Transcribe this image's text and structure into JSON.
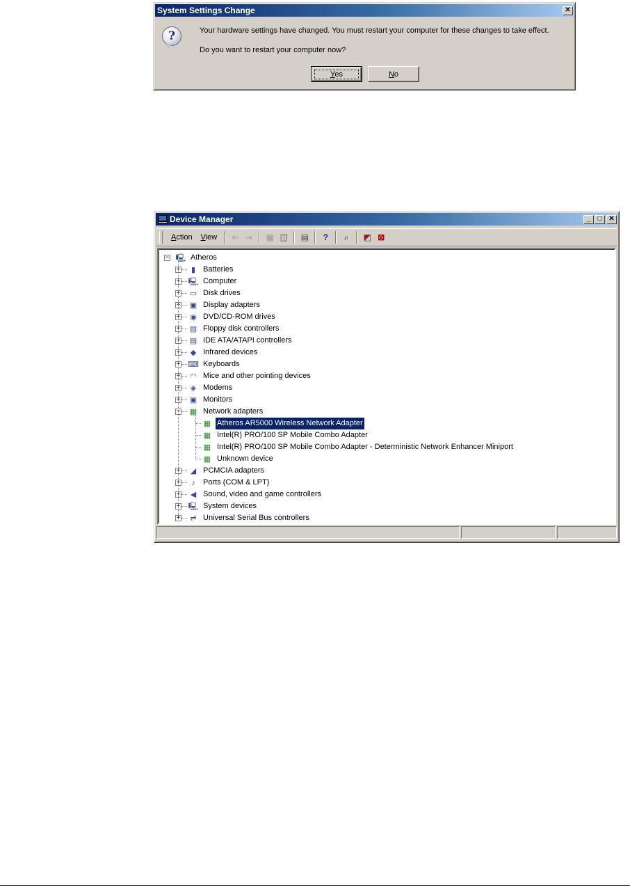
{
  "dialog": {
    "title": "System Settings Change",
    "close_glyph": "✕",
    "icon": "question-icon",
    "icon_glyph": "?",
    "message": "Your hardware settings have changed. You must restart your computer for these changes to take effect.",
    "question": "Do you want to restart your computer now?",
    "yes_first": "Y",
    "yes_rest": "es",
    "no_first": "N",
    "no_rest": "o"
  },
  "device_manager": {
    "title": "Device Manager",
    "window_buttons": {
      "minimize": "_",
      "maximize": "□",
      "close": "✕"
    },
    "menus": [
      {
        "first": "A",
        "rest": "ction"
      },
      {
        "first": "V",
        "rest": "iew"
      }
    ],
    "toolbar_icons": {
      "back": "⇐",
      "forward": "⇒",
      "up": "▦",
      "show_hide": "◫",
      "properties": "▤",
      "help": "?",
      "scan": "⌕",
      "update": "◩",
      "uninstall": "⊠"
    },
    "tree": {
      "root": "Atheros",
      "categories": [
        {
          "label": "Batteries",
          "icon": "battery-icon",
          "glyph": "▮"
        },
        {
          "label": "Computer",
          "icon": "computer-icon",
          "glyph": "🖳"
        },
        {
          "label": "Disk drives",
          "icon": "disk-drive-icon",
          "glyph": "▭"
        },
        {
          "label": "Display adapters",
          "icon": "display-adapter-icon",
          "glyph": "▣"
        },
        {
          "label": "DVD/CD-ROM drives",
          "icon": "cdrom-icon",
          "glyph": "◉"
        },
        {
          "label": "Floppy disk controllers",
          "icon": "floppy-controller-icon",
          "glyph": "▤"
        },
        {
          "label": "IDE ATA/ATAPI controllers",
          "icon": "ide-controller-icon",
          "glyph": "▤"
        },
        {
          "label": "Infrared devices",
          "icon": "infrared-icon",
          "glyph": "◆"
        },
        {
          "label": "Keyboards",
          "icon": "keyboard-icon",
          "glyph": "⌨"
        },
        {
          "label": "Mice and other pointing devices",
          "icon": "mouse-icon",
          "glyph": "◠"
        },
        {
          "label": "Modems",
          "icon": "modem-icon",
          "glyph": "◈"
        },
        {
          "label": "Monitors",
          "icon": "monitor-icon",
          "glyph": "▣"
        },
        {
          "label": "Network adapters",
          "icon": "network-adapter-icon",
          "glyph": "▦"
        },
        {
          "label": "PCMCIA adapters",
          "icon": "pcmcia-icon",
          "glyph": "◢"
        },
        {
          "label": "Ports (COM & LPT)",
          "icon": "port-icon",
          "glyph": "♪"
        },
        {
          "label": "Sound, video and game controllers",
          "icon": "sound-icon",
          "glyph": "◀"
        },
        {
          "label": "System devices",
          "icon": "system-device-icon",
          "glyph": "🖳"
        },
        {
          "label": "Universal Serial Bus controllers",
          "icon": "usb-icon",
          "glyph": "⇌"
        }
      ],
      "network_children": [
        "Atheros AR5000 Wireless Network Adapter",
        "Intel(R) PRO/100 SP Mobile Combo Adapter",
        "Intel(R) PRO/100 SP Mobile Combo Adapter - Deterministic Network Enhancer Miniport",
        "Unknown device"
      ],
      "selected_child_index": 0,
      "expand_glyph": "+",
      "collapse_glyph": "−"
    }
  },
  "colors": {
    "titlebar_start": "#0a246a",
    "titlebar_end": "#a6caf0",
    "window_face": "#d4d0c8",
    "selection": "#0a246a",
    "network_icon_green": "#2c8a2c"
  }
}
